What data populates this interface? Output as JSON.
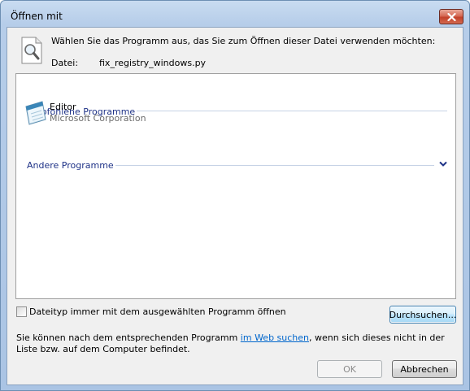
{
  "window": {
    "title": "Öffnen mit",
    "accent": "#1e3287",
    "close_color": "#c2412a"
  },
  "header": {
    "icon": "magnifier-document-icon",
    "prompt": "Wählen Sie das Programm aus, das Sie zum Öffnen dieser Datei verwenden möchten:",
    "file_label": "Datei:",
    "file_name": "fix_registry_windows.py"
  },
  "list": {
    "recommended_header": "Empfohlene Programme",
    "programs": [
      {
        "name": "Editor",
        "vendor": "Microsoft Corporation",
        "icon": "notepad-icon"
      }
    ],
    "other_header": "Andere Programme",
    "expand_icon": "chevron-down-icon"
  },
  "options": {
    "always_use_label": "Dateityp immer mit dem ausgewählten Programm öffnen",
    "always_use_checked": false,
    "browse_label": "Durchsuchen..."
  },
  "help": {
    "text_before": "Sie können nach dem entsprechenden Programm ",
    "link_text": "im Web suchen",
    "text_after": ", wenn sich dieses nicht in der Liste bzw. auf dem Computer befindet."
  },
  "buttons": {
    "ok_label": "OK",
    "ok_enabled": false,
    "cancel_label": "Abbrechen"
  }
}
